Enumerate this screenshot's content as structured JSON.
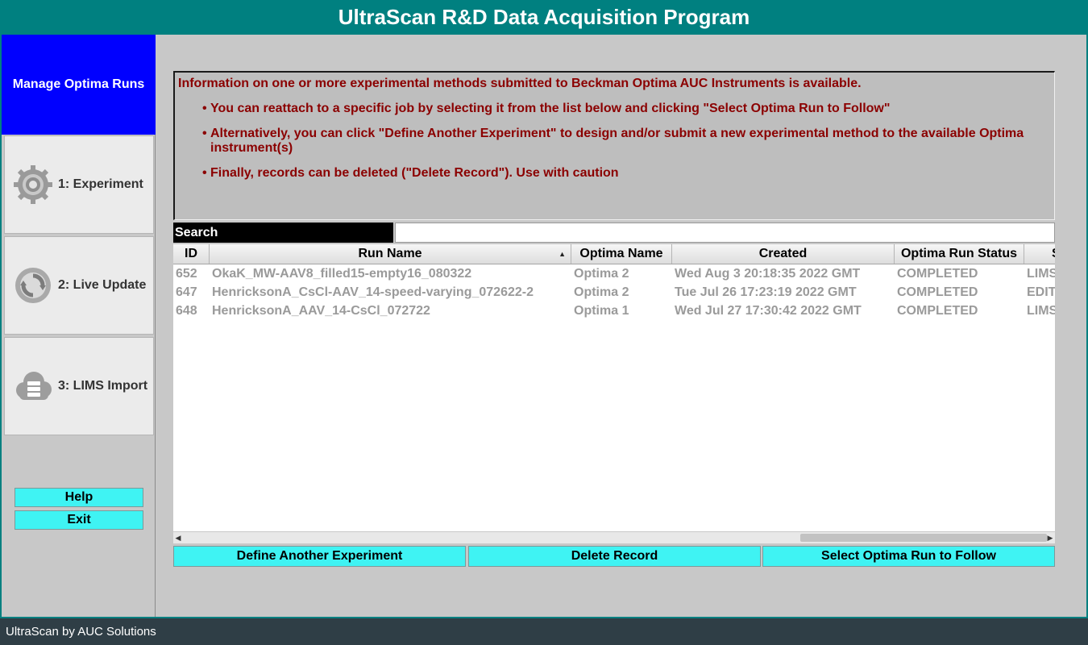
{
  "window": {
    "title": "UltraScan R&D Data Acquisition Program"
  },
  "sidebar": {
    "active_label": "Manage Optima Runs",
    "items": [
      {
        "label": "1: Experiment",
        "icon": "gear-icon"
      },
      {
        "label": "2: Live Update",
        "icon": "refresh-icon"
      },
      {
        "label": "3: LIMS Import",
        "icon": "cloud-database-icon"
      }
    ],
    "help_label": "Help",
    "exit_label": "Exit"
  },
  "info": {
    "heading": "Information on one or more experimental methods submitted to Beckman Optima AUC Instruments is available.",
    "bullets": [
      "You can reattach to a specific job by selecting it from the list below and clicking \"Select Optima Run to Follow\"",
      "Alternatively, you can click \"Define Another Experiment\" to design and/or submit a new experimental method to the available Optima instrument(s)",
      "Finally, records can be deleted (\"Delete Record\"). Use with caution"
    ],
    "bullet_char": "•"
  },
  "search": {
    "label": "Search",
    "value": ""
  },
  "table": {
    "columns": [
      "ID",
      "Run Name",
      "Optima Name",
      "Created",
      "Optima Run Status",
      "S"
    ],
    "rows": [
      [
        "652",
        "OkaK_MW-AAV8_filled15-empty16_080322",
        "Optima 2",
        "Wed Aug 3 20:18:35 2022 GMT",
        "COMPLETED",
        "LIMS"
      ],
      [
        "647",
        "HenricksonA_CsCl-AAV_14-speed-varying_072622-2",
        "Optima 2",
        "Tue Jul 26 17:23:19 2022 GMT",
        "COMPLETED",
        "EDIT"
      ],
      [
        "648",
        "HenricksonA_AAV_14-CsCl_072722",
        "Optima 1",
        "Wed Jul 27 17:30:42 2022 GMT",
        "COMPLETED",
        "LIMS"
      ]
    ]
  },
  "actions": {
    "define": "Define Another Experiment",
    "delete": "Delete Record",
    "select": "Select Optima Run to Follow"
  },
  "status": {
    "text": "UltraScan by AUC Solutions"
  },
  "colors": {
    "teal": "#008080",
    "active_blue": "#0000ff",
    "button_cyan": "#3ff3f3",
    "info_text": "#8b0000"
  }
}
